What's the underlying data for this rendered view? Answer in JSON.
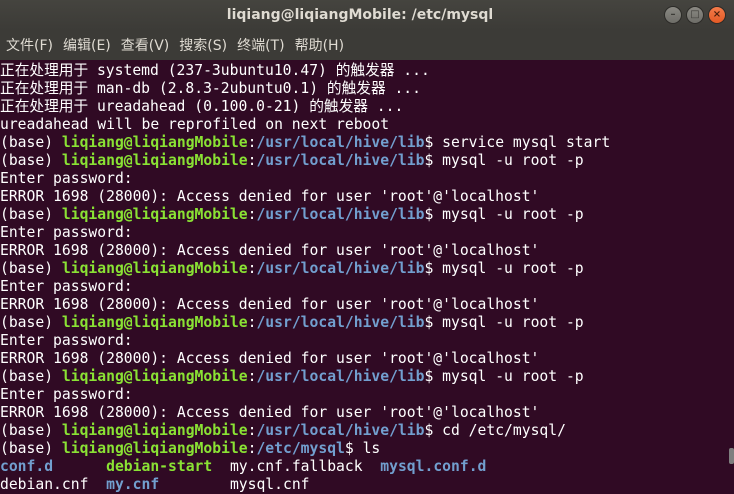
{
  "window": {
    "title": "liqiang@liqiangMobile: /etc/mysql"
  },
  "menu": {
    "items": [
      {
        "label": "文件(F)"
      },
      {
        "label": "编辑(E)"
      },
      {
        "label": "查看(V)"
      },
      {
        "label": "搜索(S)"
      },
      {
        "label": "终端(T)"
      },
      {
        "label": "帮助(H)"
      }
    ]
  },
  "terminal": {
    "colors": {
      "background": "#300a24",
      "text": "#ffffff",
      "user_host": "#8ae234",
      "path": "#729fcf",
      "directory": "#729fcf"
    },
    "lines": [
      [
        {
          "t": "正在处理用于 systemd (237-3ubuntu10.47) 的触发器 ...",
          "c": "w"
        }
      ],
      [
        {
          "t": "正在处理用于 man-db (2.8.3-2ubuntu0.1) 的触发器 ...",
          "c": "w"
        }
      ],
      [
        {
          "t": "正在处理用于 ureadahead (0.100.0-21) 的触发器 ...",
          "c": "w"
        }
      ],
      [
        {
          "t": "ureadahead will be reprofiled on next reboot",
          "c": "w"
        }
      ],
      [
        {
          "t": "(base) ",
          "c": "w"
        },
        {
          "t": "liqiang@liqiangMobile",
          "c": "g"
        },
        {
          "t": ":",
          "c": "w"
        },
        {
          "t": "/usr/local/hive/lib",
          "c": "b"
        },
        {
          "t": "$ service mysql start",
          "c": "w"
        }
      ],
      [
        {
          "t": "(base) ",
          "c": "w"
        },
        {
          "t": "liqiang@liqiangMobile",
          "c": "g"
        },
        {
          "t": ":",
          "c": "w"
        },
        {
          "t": "/usr/local/hive/lib",
          "c": "b"
        },
        {
          "t": "$ mysql -u root -p",
          "c": "w"
        }
      ],
      [
        {
          "t": "Enter password:",
          "c": "w"
        }
      ],
      [
        {
          "t": "ERROR 1698 (28000): Access denied for user 'root'@'localhost'",
          "c": "w"
        }
      ],
      [
        {
          "t": "(base) ",
          "c": "w"
        },
        {
          "t": "liqiang@liqiangMobile",
          "c": "g"
        },
        {
          "t": ":",
          "c": "w"
        },
        {
          "t": "/usr/local/hive/lib",
          "c": "b"
        },
        {
          "t": "$ mysql -u root -p",
          "c": "w"
        }
      ],
      [
        {
          "t": "Enter password:",
          "c": "w"
        }
      ],
      [
        {
          "t": "ERROR 1698 (28000): Access denied for user 'root'@'localhost'",
          "c": "w"
        }
      ],
      [
        {
          "t": "(base) ",
          "c": "w"
        },
        {
          "t": "liqiang@liqiangMobile",
          "c": "g"
        },
        {
          "t": ":",
          "c": "w"
        },
        {
          "t": "/usr/local/hive/lib",
          "c": "b"
        },
        {
          "t": "$ mysql -u root -p",
          "c": "w"
        }
      ],
      [
        {
          "t": "Enter password:",
          "c": "w"
        }
      ],
      [
        {
          "t": "ERROR 1698 (28000): Access denied for user 'root'@'localhost'",
          "c": "w"
        }
      ],
      [
        {
          "t": "(base) ",
          "c": "w"
        },
        {
          "t": "liqiang@liqiangMobile",
          "c": "g"
        },
        {
          "t": ":",
          "c": "w"
        },
        {
          "t": "/usr/local/hive/lib",
          "c": "b"
        },
        {
          "t": "$ mysql -u root -p",
          "c": "w"
        }
      ],
      [
        {
          "t": "Enter password:",
          "c": "w"
        }
      ],
      [
        {
          "t": "ERROR 1698 (28000): Access denied for user 'root'@'localhost'",
          "c": "w"
        }
      ],
      [
        {
          "t": "(base) ",
          "c": "w"
        },
        {
          "t": "liqiang@liqiangMobile",
          "c": "g"
        },
        {
          "t": ":",
          "c": "w"
        },
        {
          "t": "/usr/local/hive/lib",
          "c": "b"
        },
        {
          "t": "$ mysql -u root -p",
          "c": "w"
        }
      ],
      [
        {
          "t": "Enter password:",
          "c": "w"
        }
      ],
      [
        {
          "t": "ERROR 1698 (28000): Access denied for user 'root'@'localhost'",
          "c": "w"
        }
      ],
      [
        {
          "t": "(base) ",
          "c": "w"
        },
        {
          "t": "liqiang@liqiangMobile",
          "c": "g"
        },
        {
          "t": ":",
          "c": "w"
        },
        {
          "t": "/usr/local/hive/lib",
          "c": "b"
        },
        {
          "t": "$ cd /etc/mysql/",
          "c": "w"
        }
      ],
      [
        {
          "t": "(base) ",
          "c": "w"
        },
        {
          "t": "liqiang@liqiangMobile",
          "c": "g"
        },
        {
          "t": ":",
          "c": "w"
        },
        {
          "t": "/etc/mysql",
          "c": "b"
        },
        {
          "t": "$ ls",
          "c": "w"
        }
      ],
      [
        {
          "t": "conf.d",
          "c": "b"
        },
        {
          "t": "      ",
          "c": "w"
        },
        {
          "t": "debian-start",
          "c": "g"
        },
        {
          "t": "  ",
          "c": "w"
        },
        {
          "t": "my.cnf.fallback",
          "c": "w"
        },
        {
          "t": "  ",
          "c": "w"
        },
        {
          "t": "mysql.conf.d",
          "c": "b"
        }
      ],
      [
        {
          "t": "debian.cnf",
          "c": "w"
        },
        {
          "t": "  ",
          "c": "w"
        },
        {
          "t": "my.cnf",
          "c": "b"
        },
        {
          "t": "        ",
          "c": "w"
        },
        {
          "t": "mysql.cnf",
          "c": "w"
        }
      ]
    ]
  }
}
